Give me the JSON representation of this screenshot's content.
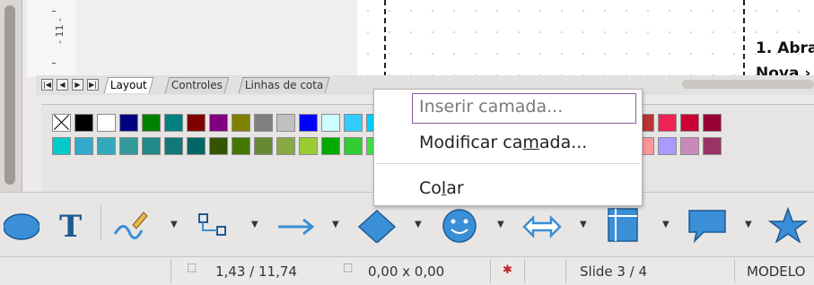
{
  "ruler": {
    "label": "- 11 -"
  },
  "slide": {
    "text_line1": "1. Abra",
    "text_line2": "Nova ›"
  },
  "tabs": [
    {
      "label": "Layout",
      "active": true
    },
    {
      "label": "Controles",
      "active": false
    },
    {
      "label": "Linhas de cota",
      "active": false
    }
  ],
  "nav_buttons": [
    "|◀",
    "◀",
    "▶",
    "▶|"
  ],
  "palette": {
    "row1": [
      "none",
      "#000000",
      "#ffffff",
      "#000080",
      "#008000",
      "#008080",
      "#800000",
      "#800080",
      "#808000",
      "#808080",
      "#c0c0c0",
      "#0000ff",
      "#ccffff",
      "#33ccff",
      "#00ccff",
      "#0066cc",
      "#3366ff",
      "#ff0000",
      "#ff3333",
      "#cc0000",
      "#ff6600",
      "#cc3300",
      "#993300",
      "#ff0033",
      "#ee3333",
      "#ff3366",
      "#bb3333",
      "#ee2255",
      "#cc0033",
      "#990033"
    ],
    "row2": [
      "#00cccc",
      "#33aacc",
      "#33aabb",
      "#339999",
      "#228888",
      "#117777",
      "#006666",
      "#335500",
      "#447700",
      "#668833",
      "#88aa44",
      "#99cc33",
      "#00aa00",
      "#33cc33",
      "#44dd44",
      "#66ee66",
      "#55cc55",
      "#44bb44",
      "#aa6633",
      "#996633",
      "#cc6633",
      "#aa5522",
      "#dd6633",
      "#ff6644",
      "#ffaa88",
      "#ffcc99",
      "#ff9999",
      "#aa99ff",
      "#cc88bb",
      "#993366"
    ]
  },
  "context_menu": {
    "items": [
      {
        "label": "Inserir camada...",
        "enabled": false,
        "highlighted": true
      },
      {
        "label": "Modificar camada...",
        "enabled": true
      },
      {
        "label": "Colar",
        "enabled": true
      }
    ]
  },
  "toolbar": {
    "items": [
      "ellipse-tool",
      "text-tool",
      "curve-tool",
      "connector-tool",
      "line-arrow-tool",
      "basic-shapes-tool",
      "symbol-shapes-tool",
      "block-arrows-tool",
      "flowchart-tool",
      "callouts-tool",
      "stars-tool"
    ]
  },
  "statusbar": {
    "position": "1,43 / 11,74",
    "size": "0,00 x 0,00",
    "slide": "Slide 3 / 4",
    "master": "MODELO"
  },
  "colors": {
    "accent": "#8b5aa0",
    "icon_blue": "#3a8fd6"
  }
}
